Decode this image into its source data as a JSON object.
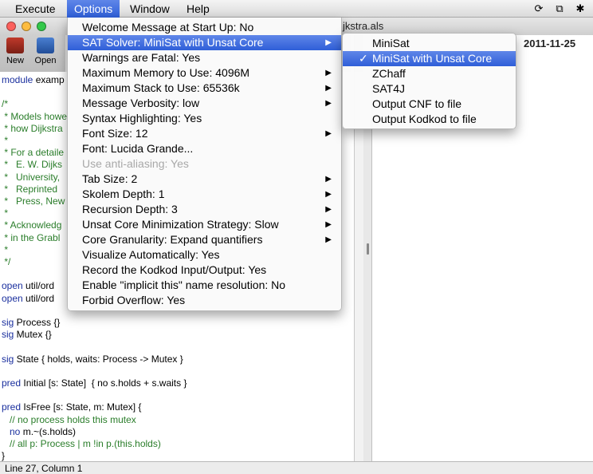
{
  "menubar": {
    "items": [
      {
        "label": "Execute",
        "active": false
      },
      {
        "label": "Options",
        "active": true
      },
      {
        "label": "Window",
        "active": false
      },
      {
        "label": "Help",
        "active": false
      }
    ],
    "tray_icons": [
      "sync-icon",
      "window-icon",
      "bluetooth-icon"
    ]
  },
  "window": {
    "title_fragment": "jkstra.als",
    "traffic_lights": {
      "close": "#fc605c",
      "minimize": "#fdbc40",
      "zoom": "#34c84a"
    }
  },
  "toolbar": {
    "buttons": [
      {
        "label": "New",
        "icon": "new-file-icon"
      },
      {
        "label": "Open",
        "icon": "open-folder-icon"
      }
    ]
  },
  "right_pane": {
    "header": "2011-11-25"
  },
  "editor": {
    "lines": [
      {
        "kw": "module",
        "text": " examp",
        "type": "code"
      },
      {
        "kw": "",
        "text": "",
        "type": "code"
      },
      {
        "kw": "",
        "text": "/*",
        "type": "comment"
      },
      {
        "kw": "",
        "text": " * Models howe",
        "type": "comment"
      },
      {
        "kw": "",
        "text": " * how Dijkstra",
        "type": "comment"
      },
      {
        "kw": "",
        "text": " *",
        "type": "comment"
      },
      {
        "kw": "",
        "text": " * For a detaile",
        "type": "comment"
      },
      {
        "kw": "",
        "text": " *   E. W. Dijks",
        "type": "comment"
      },
      {
        "kw": "",
        "text": " *   University,",
        "type": "comment"
      },
      {
        "kw": "",
        "text": " *   Reprinted",
        "type": "comment"
      },
      {
        "kw": "",
        "text": " *   Press, New",
        "type": "comment"
      },
      {
        "kw": "",
        "text": " *",
        "type": "comment"
      },
      {
        "kw": "",
        "text": " * Acknowledg",
        "type": "comment"
      },
      {
        "kw": "",
        "text": " * in the Grabl",
        "type": "comment"
      },
      {
        "kw": "",
        "text": " *",
        "type": "comment"
      },
      {
        "kw": "",
        "text": " */",
        "type": "comment"
      },
      {
        "kw": "",
        "text": "",
        "type": "code"
      },
      {
        "kw": "open",
        "text": " util/ord",
        "type": "code"
      },
      {
        "kw": "open",
        "text": " util/ord",
        "type": "code"
      },
      {
        "kw": "",
        "text": "",
        "type": "code"
      },
      {
        "kw": "sig",
        "text": " Process {}",
        "type": "code"
      },
      {
        "kw": "sig",
        "text": " Mutex {}",
        "type": "code"
      },
      {
        "kw": "",
        "text": "",
        "type": "code"
      },
      {
        "kw": "sig",
        "text": " State { holds, waits: Process -> Mutex }",
        "type": "code"
      },
      {
        "kw": "",
        "text": "",
        "type": "code"
      },
      {
        "kw": "pred",
        "text": " Initial [s: State]  { no s.holds + s.waits }",
        "type": "code"
      },
      {
        "kw": "",
        "text": "",
        "type": "code"
      },
      {
        "kw": "pred",
        "text": " IsFree [s: State, m: Mutex] {",
        "type": "code"
      },
      {
        "kw": "",
        "text": "   // no process holds this mutex",
        "type": "comment"
      },
      {
        "kw": "   no",
        "text": " m.~(s.holds)",
        "type": "code"
      },
      {
        "kw": "",
        "text": "   // all p: Process | m !in p.(this.holds)",
        "type": "comment"
      },
      {
        "kw": "",
        "text": "}",
        "type": "code"
      }
    ]
  },
  "status": {
    "text": "Line 27, Column 1"
  },
  "options_menu": {
    "items": [
      {
        "label": "Welcome Message at Start Up: No",
        "submenu": false,
        "highlighted": false,
        "disabled": false
      },
      {
        "label": "SAT Solver: MiniSat with Unsat Core",
        "submenu": true,
        "highlighted": true,
        "disabled": false
      },
      {
        "label": "Warnings are Fatal: Yes",
        "submenu": false,
        "highlighted": false,
        "disabled": false
      },
      {
        "label": "Maximum Memory to Use: 4096M",
        "submenu": true,
        "highlighted": false,
        "disabled": false
      },
      {
        "label": "Maximum Stack to Use: 65536k",
        "submenu": true,
        "highlighted": false,
        "disabled": false
      },
      {
        "label": "Message Verbosity: low",
        "submenu": true,
        "highlighted": false,
        "disabled": false
      },
      {
        "label": "Syntax Highlighting: Yes",
        "submenu": false,
        "highlighted": false,
        "disabled": false
      },
      {
        "label": "Font Size: 12",
        "submenu": true,
        "highlighted": false,
        "disabled": false
      },
      {
        "label": "Font: Lucida Grande...",
        "submenu": false,
        "highlighted": false,
        "disabled": false
      },
      {
        "label": "Use anti-aliasing: Yes",
        "submenu": false,
        "highlighted": false,
        "disabled": true
      },
      {
        "label": "Tab Size: 2",
        "submenu": true,
        "highlighted": false,
        "disabled": false
      },
      {
        "label": "Skolem Depth: 1",
        "submenu": true,
        "highlighted": false,
        "disabled": false
      },
      {
        "label": "Recursion Depth: 3",
        "submenu": true,
        "highlighted": false,
        "disabled": false
      },
      {
        "label": "Unsat Core Minimization Strategy: Slow",
        "submenu": true,
        "highlighted": false,
        "disabled": false
      },
      {
        "label": "Core Granularity: Expand quantifiers",
        "submenu": true,
        "highlighted": false,
        "disabled": false
      },
      {
        "label": "Visualize Automatically: Yes",
        "submenu": false,
        "highlighted": false,
        "disabled": false
      },
      {
        "label": "Record the Kodkod Input/Output: Yes",
        "submenu": false,
        "highlighted": false,
        "disabled": false
      },
      {
        "label": "Enable \"implicit this\" name resolution: No",
        "submenu": false,
        "highlighted": false,
        "disabled": false
      },
      {
        "label": "Forbid Overflow: Yes",
        "submenu": false,
        "highlighted": false,
        "disabled": false
      }
    ]
  },
  "sat_submenu": {
    "items": [
      {
        "label": "MiniSat",
        "checked": false,
        "highlighted": false
      },
      {
        "label": "MiniSat with Unsat Core",
        "checked": true,
        "highlighted": true
      },
      {
        "label": "ZChaff",
        "checked": false,
        "highlighted": false
      },
      {
        "label": "SAT4J",
        "checked": false,
        "highlighted": false
      },
      {
        "label": "Output CNF to file",
        "checked": false,
        "highlighted": false
      },
      {
        "label": "Output Kodkod to file",
        "checked": false,
        "highlighted": false
      }
    ],
    "check_glyph": "✓"
  },
  "colors": {
    "highlight": "#2f5fd8",
    "keyword": "#1a2f9e",
    "comment": "#2a7d2a"
  }
}
